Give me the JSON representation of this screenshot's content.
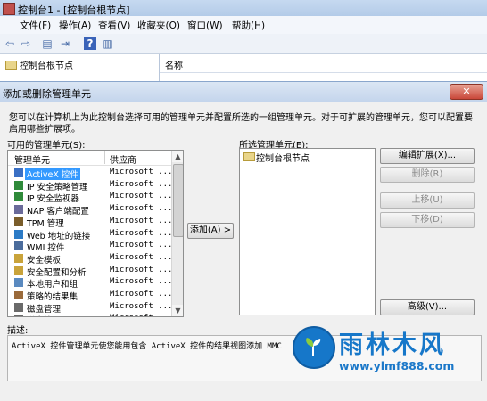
{
  "mmc": {
    "title": "控制台1 - [控制台根节点]",
    "menus": [
      "文件(F)",
      "操作(A)",
      "查看(V)",
      "收藏夹(O)",
      "窗口(W)",
      "帮助(H)"
    ],
    "tree_root": "控制台根节点",
    "column_name": "名称"
  },
  "dialog": {
    "title": "添加或删除管理单元",
    "close": "✕",
    "description": "您可以在计算机上为此控制台选择可用的管理单元并配置所选的一组管理单元。对于可扩展的管理单元，您可以配置要启用哪些扩展项。",
    "available_label": "可用的管理单元(S):",
    "available_columns": [
      "管理单元",
      "供应商"
    ],
    "available_items": [
      {
        "name": "ActiveX 控件",
        "vendor": "Microsoft ...",
        "icon": "activex-icon",
        "selected": true
      },
      {
        "name": "IP 安全策略管理",
        "vendor": "Microsoft ...",
        "icon": "ip-security-policy-icon"
      },
      {
        "name": "IP 安全监视器",
        "vendor": "Microsoft ...",
        "icon": "ip-security-monitor-icon"
      },
      {
        "name": "NAP 客户端配置",
        "vendor": "Microsoft ...",
        "icon": "nap-client-icon"
      },
      {
        "name": "TPM 管理",
        "vendor": "Microsoft ...",
        "icon": "tpm-icon"
      },
      {
        "name": "Web 地址的链接",
        "vendor": "Microsoft ...",
        "icon": "web-link-icon"
      },
      {
        "name": "WMI 控件",
        "vendor": "Microsoft ...",
        "icon": "wmi-icon"
      },
      {
        "name": "安全模板",
        "vendor": "Microsoft ...",
        "icon": "security-template-icon"
      },
      {
        "name": "安全配置和分析",
        "vendor": "Microsoft ...",
        "icon": "security-config-icon"
      },
      {
        "name": "本地用户和组",
        "vendor": "Microsoft ...",
        "icon": "local-users-icon"
      },
      {
        "name": "策略的结果集",
        "vendor": "Microsoft ...",
        "icon": "rsop-icon"
      },
      {
        "name": "磁盘管理",
        "vendor": "Microsoft ...",
        "icon": "disk-management-icon"
      },
      {
        "name": "磁盘管理",
        "vendor": "Microsoft ...",
        "icon": "disk-management-icon"
      }
    ],
    "add_button": "添加(A) >",
    "selected_label": "所选管理单元(E):",
    "selected_items": [
      "控制台根节点"
    ],
    "buttons": {
      "edit_extensions": "编辑扩展(X)...",
      "remove": "删除(R)",
      "move_up": "上移(U)",
      "move_down": "下移(D)",
      "advanced": "高级(V)..."
    },
    "desc_label": "描述:",
    "desc_text": "ActiveX 控件管理单元使您能用包含 ActiveX 控件的结果视图添加 MMC"
  },
  "watermark": {
    "brand": "雨林木风",
    "url": "www.ylmf888.com"
  }
}
